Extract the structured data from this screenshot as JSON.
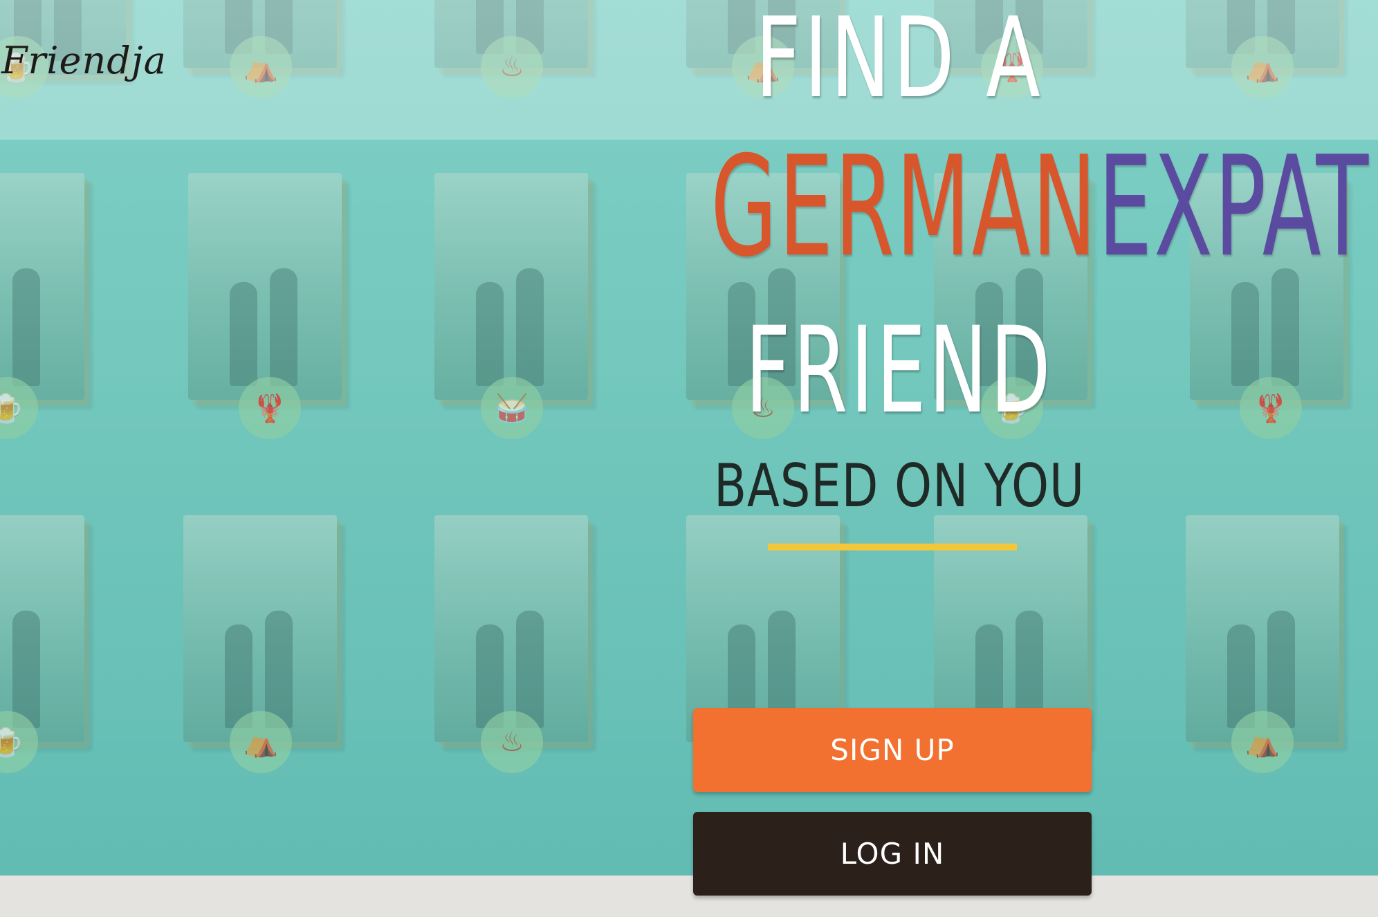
{
  "brand": {
    "logo_text": "Friendja"
  },
  "hero": {
    "line1": "FIND A",
    "word_german": "GERMAN",
    "word_expat": "EXPAT",
    "line3": "FRIEND",
    "subheading": "BASED ON YOU"
  },
  "actions": {
    "signup_label": "SIGN UP",
    "login_label": "LOG IN"
  },
  "colors": {
    "background_teal": "#74c8bd",
    "accent_orange": "#f27130",
    "dark_button": "#2b201a",
    "underline_yellow": "#f4c63a",
    "german_red_orange": "#d8562c",
    "expat_purple": "#5a4aa0"
  },
  "background_tiles": {
    "badge_icons": [
      "circus-tent-icon",
      "sausage-grill-icon",
      "lobster-icon",
      "drum-icon",
      "beer-icon"
    ]
  }
}
